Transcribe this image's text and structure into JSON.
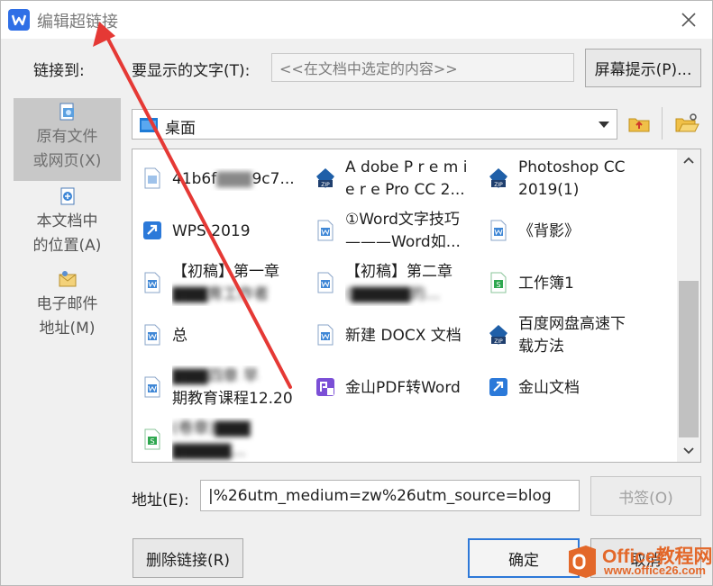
{
  "window": {
    "title": "编辑超链接",
    "app_icon": "wps-writer-icon",
    "close_icon": "close-icon"
  },
  "link_to": {
    "label": "链接到:"
  },
  "display_text": {
    "label": "要显示的文字(T):",
    "value": "<<在文档中选定的内容>>"
  },
  "screen_tip_button": "屏幕提示(P)...",
  "nav": {
    "items": [
      {
        "label_1": "原有文件",
        "label_2": "或网页(X)",
        "icon": "existing-file-icon",
        "active": true
      },
      {
        "label_1": "本文档中",
        "label_2": "的位置(A)",
        "icon": "place-in-document-icon",
        "active": false
      },
      {
        "label_1": "电子邮件",
        "label_2": "地址(M)",
        "icon": "email-address-icon",
        "active": false
      }
    ]
  },
  "folder": {
    "current": "桌面",
    "icon": "folder-icon",
    "up_icon": "folder-up-icon",
    "browse_icon": "browse-folder-icon"
  },
  "files": [
    {
      "line1": "41b6f",
      "line1_blur": "▇▇▇",
      "line1_end": "9c7...",
      "line2": "",
      "type": "doc"
    },
    {
      "line1": "A dobe P r e m i",
      "line2": "e r e Pro CC 2...",
      "type": "zip"
    },
    {
      "line1": "Photoshop CC",
      "line2": "2019(1)",
      "type": "zip"
    },
    {
      "line1": "WPS 2019",
      "line2": "",
      "type": "shortcut"
    },
    {
      "line1": "①Word文字技巧",
      "line2": "———Word如...",
      "type": "wps"
    },
    {
      "line1": "《背影》",
      "line2": "",
      "type": "wps"
    },
    {
      "line1": "【初稿】第一章",
      "line2": "▇▇▇育工作者",
      "type": "wps"
    },
    {
      "line1": "【初稿】第二章",
      "line2": "(▇▇▇▇▇的...",
      "type": "wps"
    },
    {
      "line1": "工作簿1",
      "line2": "",
      "type": "sheet"
    },
    {
      "line1": "总",
      "line2": "",
      "type": "wps"
    },
    {
      "line1": "新建 DOCX 文档",
      "line2": "",
      "type": "wps"
    },
    {
      "line1": "百度网盘高速下",
      "line2": "载方法",
      "type": "zip"
    },
    {
      "line1": "▇▇▇四章 早",
      "line2": "期教育课程12.20",
      "type": "wps"
    },
    {
      "line1": "金山PDF转Word",
      "line2": "",
      "type": "pdf"
    },
    {
      "line1": "金山文档",
      "line2": "",
      "type": "shortcut"
    },
    {
      "line1": "(卷章)▇▇▇",
      "line2": "▇▇▇▇▇...",
      "type": "sheet"
    }
  ],
  "address": {
    "label": "地址(E):",
    "value": "|%26utm_medium=zw%26utm_source=blog"
  },
  "bookmark_button": "书签(O)",
  "remove_link_button": "删除链接(R)",
  "ok_button": "确定",
  "cancel_button": "取消",
  "watermark": {
    "line1": "Office教程网",
    "line2": "www.office26.com"
  },
  "colors": {
    "title_gray": "#7a7a7a",
    "accent_blue": "#2d78d8",
    "annotation_red": "#e53935",
    "watermark_orange": "#e3682a"
  }
}
